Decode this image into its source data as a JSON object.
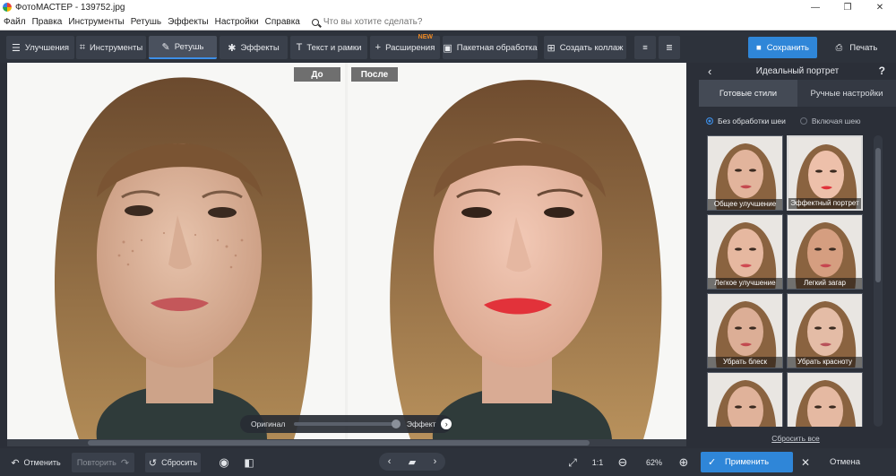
{
  "window": {
    "title": "ФотоМАСТЕР - 139752.jpg",
    "controls": [
      "—",
      "❐",
      "✕"
    ]
  },
  "menu": {
    "items": [
      "Файл",
      "Правка",
      "Инструменты",
      "Ретушь",
      "Эффекты",
      "Настройки",
      "Справка"
    ],
    "search_placeholder": "Что вы хотите сделать?"
  },
  "toolbar": {
    "tabs": [
      {
        "label": "Улучшения",
        "icon": "sliders-icon"
      },
      {
        "label": "Инструменты",
        "icon": "crop-icon"
      },
      {
        "label": "Ретушь",
        "icon": "brush-icon",
        "active": true
      },
      {
        "label": "Эффекты",
        "icon": "sparkle-icon"
      },
      {
        "label": "Текст и рамки",
        "icon": "text-icon"
      },
      {
        "label": "Расширения",
        "icon": "plus-icon",
        "badge": "NEW"
      },
      {
        "label": "Пакетная обработка",
        "icon": "images-icon"
      },
      {
        "label": "Создать коллаж",
        "icon": "collage-icon"
      }
    ],
    "save_label": "Сохранить",
    "print_label": "Печать"
  },
  "canvas": {
    "before_label": "До",
    "after_label": "После",
    "slider_left_label": "Оригинал",
    "slider_right_label": "Эффект",
    "effect_level": 1.0
  },
  "panel": {
    "title": "Идеальный портрет",
    "help": "?",
    "tabs": [
      "Готовые стили",
      "Ручные настройки"
    ],
    "active_tab": "Готовые стили",
    "radio_options": [
      "Без обработки шеи",
      "Включая шею"
    ],
    "radio_selected": "Без обработки шеи",
    "presets": [
      {
        "label": "Общее улучшение"
      },
      {
        "label": "Эффектный портрет",
        "selected": true
      },
      {
        "label": "Легкое улучшение"
      },
      {
        "label": "Легкий загар"
      },
      {
        "label": "Убрать блеск"
      },
      {
        "label": "Убрать красноту"
      },
      {
        "label": ""
      },
      {
        "label": ""
      }
    ],
    "reset_all_label": "Сбросить все"
  },
  "bottombar": {
    "undo_label": "Отменить",
    "redo_label": "Повторить",
    "reset_label": "Сбросить",
    "zoom_fit_label": "1:1",
    "zoom_level": "62%",
    "apply_label": "Применить",
    "cancel_label": "Отмена"
  },
  "colors": {
    "accent": "#2f86d8",
    "toolbar_bg": "#2d323b",
    "panel_bg": "#2b2f38",
    "badge_new": "#f08a24"
  }
}
